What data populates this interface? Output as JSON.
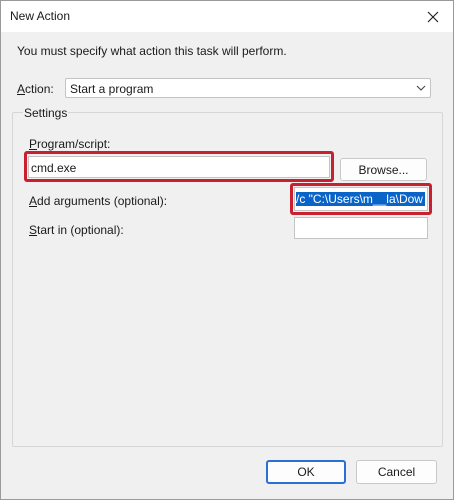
{
  "window": {
    "title": "New Action"
  },
  "instruction": "You must specify what action this task will perform.",
  "action": {
    "label_u": "A",
    "label_rest": "ction:",
    "selected": "Start a program"
  },
  "settings": {
    "title": "Settings",
    "program": {
      "label_u": "P",
      "label_rest": "rogram/script:",
      "value": "cmd.exe"
    },
    "browse_label": "Browse...",
    "arguments": {
      "label_u": "A",
      "label_rest": "dd arguments (optional):",
      "value": "/c \"C:\\Users\\m__la\\Dow"
    },
    "start_in": {
      "label_u": "S",
      "label_rest": "tart in (optional):",
      "value": ""
    }
  },
  "buttons": {
    "ok": "OK",
    "cancel": "Cancel"
  },
  "colors": {
    "highlight_red": "#c8202e",
    "selection_blue": "#0a64c8",
    "default_button_blue": "#2b6fd6"
  }
}
